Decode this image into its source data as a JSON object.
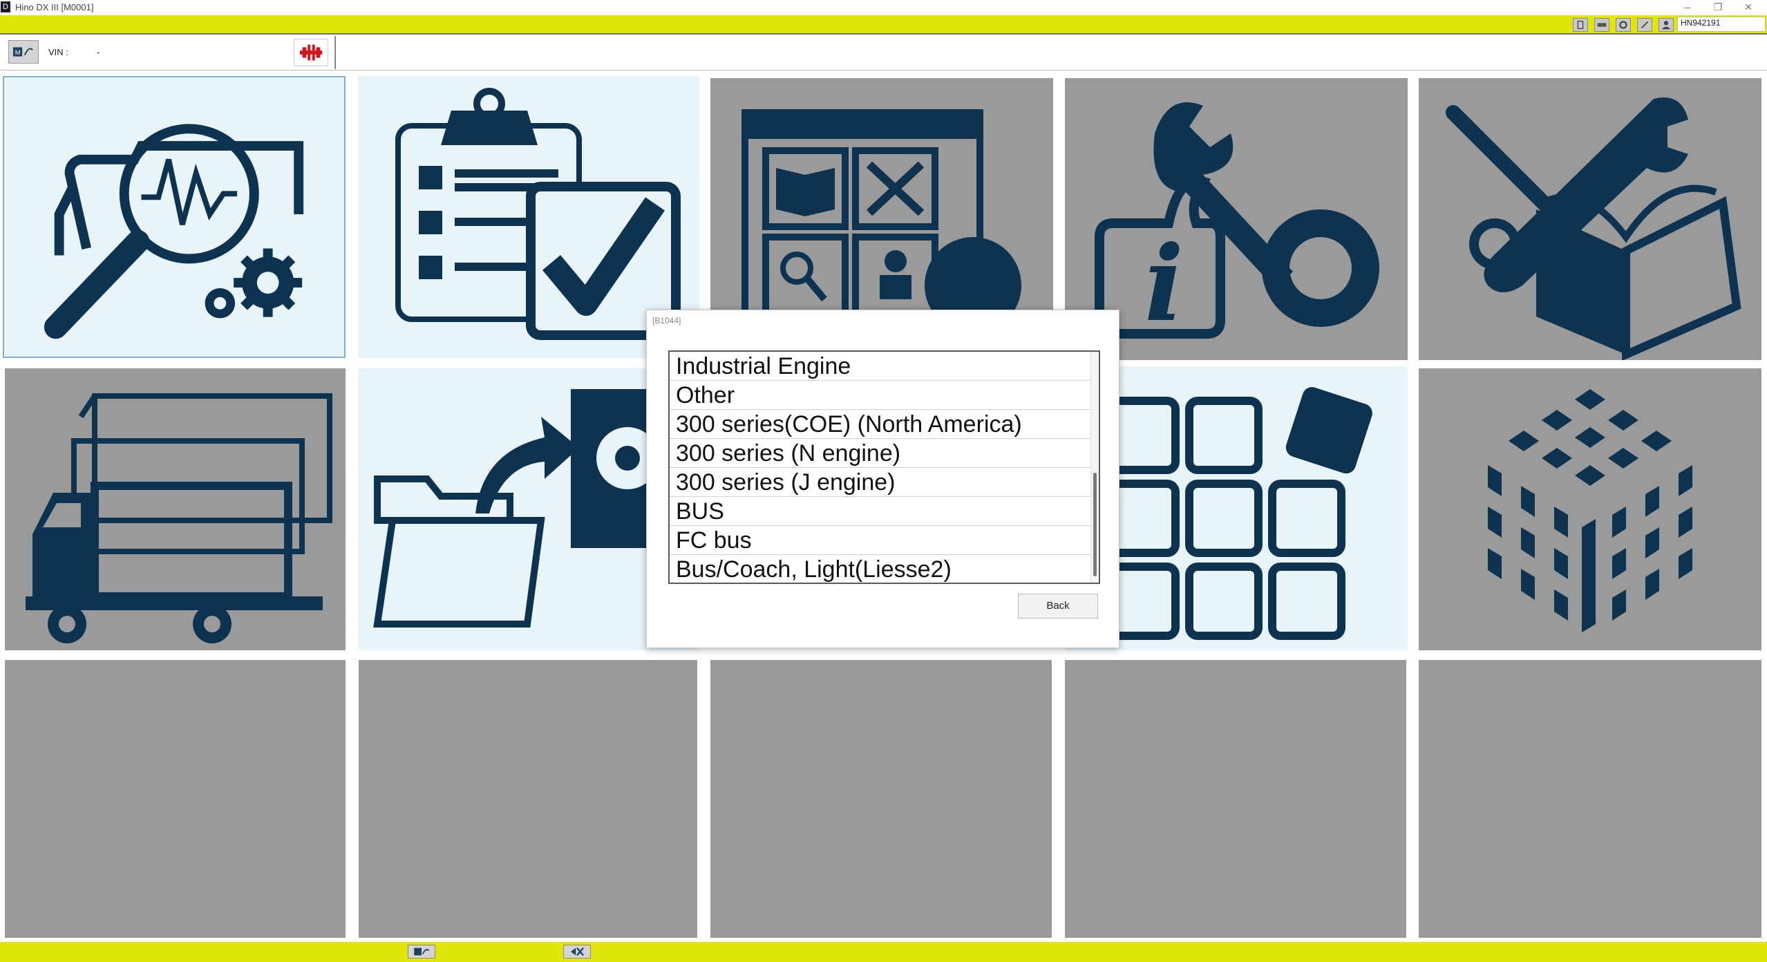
{
  "window": {
    "title": "Hino DX III [M0001]",
    "app_icon_letter": "D",
    "minimize": "–",
    "restore": "❐",
    "close": "✕"
  },
  "topbar": {
    "user_id": "HN942191"
  },
  "toolbar": {
    "vin_label": "VIN :",
    "vin_value": "-"
  },
  "colors": {
    "accent_yellow": "#e1e60a",
    "icon_navy": "#0d3350",
    "tile_gray": "#9a9a9a",
    "tile_light": "#e8f4f8",
    "connection_red": "#d4141c"
  },
  "tiles": [
    {
      "name": "diagnosis",
      "icon": "truck-magnifier-gears-icon",
      "style": "light",
      "selected": true
    },
    {
      "name": "checklist",
      "icon": "clipboard-checklist-icon",
      "style": "light"
    },
    {
      "name": "service-information",
      "icon": "window-book-tools-globe-icon",
      "style": "gray"
    },
    {
      "name": "information-tools",
      "icon": "info-wrench-gear-icon",
      "style": "gray"
    },
    {
      "name": "repair-manual",
      "icon": "tools-open-book-icon",
      "style": "gray"
    },
    {
      "name": "vehicles",
      "icon": "trucks-fleet-icon",
      "style": "gray"
    },
    {
      "name": "data-transfer",
      "icon": "folder-export-disk-icon",
      "style": "light"
    },
    {
      "name": "applications",
      "icon": "app-grid-icon",
      "style": "light"
    },
    {
      "name": "modules",
      "icon": "cube-blocks-icon",
      "style": "gray"
    },
    {
      "name": "empty",
      "icon": "",
      "style": "gray"
    },
    {
      "name": "empty",
      "icon": "",
      "style": "gray"
    },
    {
      "name": "empty",
      "icon": "",
      "style": "gray"
    },
    {
      "name": "empty",
      "icon": "",
      "style": "gray"
    },
    {
      "name": "empty",
      "icon": "",
      "style": "gray"
    }
  ],
  "dialog": {
    "code": "[B1044]",
    "items": [
      "Industrial Engine",
      "Other",
      "300 series(COE) (North America)",
      "300 series (N engine)",
      "300 series (J engine)",
      "BUS",
      "FC bus",
      "Bus/Coach, Light(Liesse2)"
    ],
    "back_label": "Back"
  }
}
